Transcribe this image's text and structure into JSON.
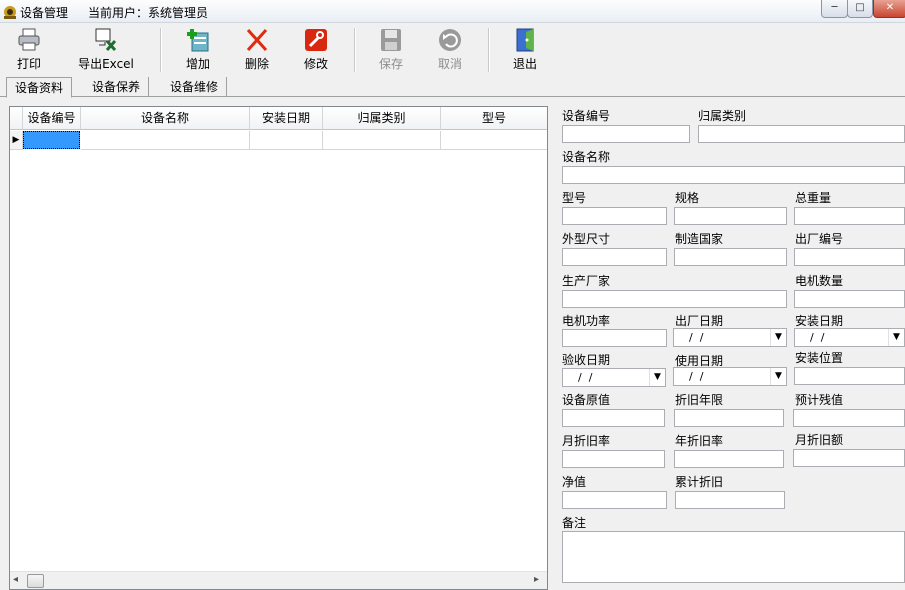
{
  "window": {
    "title": "设备管理",
    "user_text": "当前用户：系统管理员",
    "btn_minimize": "─",
    "btn_maximize": "□",
    "btn_close": "✕",
    "icon": "app-icon"
  },
  "toolbar": {
    "print": "打印",
    "export": "导出Excel",
    "add": "增加",
    "delete": "删除",
    "edit": "修改",
    "save": "保存",
    "cancel": "取消",
    "exit": "退出"
  },
  "tabs": [
    "设备资料",
    "设备保养",
    "设备维修"
  ],
  "grid": {
    "columns": [
      "设备编号",
      "设备名称",
      "安装日期",
      "归属类别",
      "型号"
    ],
    "row_marker": "▶",
    "scroll_left": "◂",
    "scroll_right": "▸"
  },
  "form": {
    "labels": {
      "device_no": "设备编号",
      "category": "归属类别",
      "device_name": "设备名称",
      "model": "型号",
      "spec": "规格",
      "total_weight": "总重量",
      "dimensions": "外型尺寸",
      "country": "制造国家",
      "factory_no": "出厂编号",
      "manufacturer": "生产厂家",
      "motor_count": "电机数量",
      "motor_power": "电机功率",
      "factory_date": "出厂日期",
      "install_date": "安装日期",
      "accept_date": "验收日期",
      "use_date": "使用日期",
      "install_location": "安装位置",
      "original_value": "设备原值",
      "depr_years": "折旧年限",
      "residual": "预计残值",
      "monthly_rate": "月折旧率",
      "yearly_rate": "年折旧率",
      "monthly_amount": "月折旧额",
      "net_value": "净值",
      "accumulated": "累计折旧",
      "remarks": "备注"
    },
    "date_placeholder": "  /  /",
    "dropdown_glyph": "▼"
  },
  "colors": {
    "selected_cell": "#3399ff",
    "close_button": "#c8452f"
  }
}
